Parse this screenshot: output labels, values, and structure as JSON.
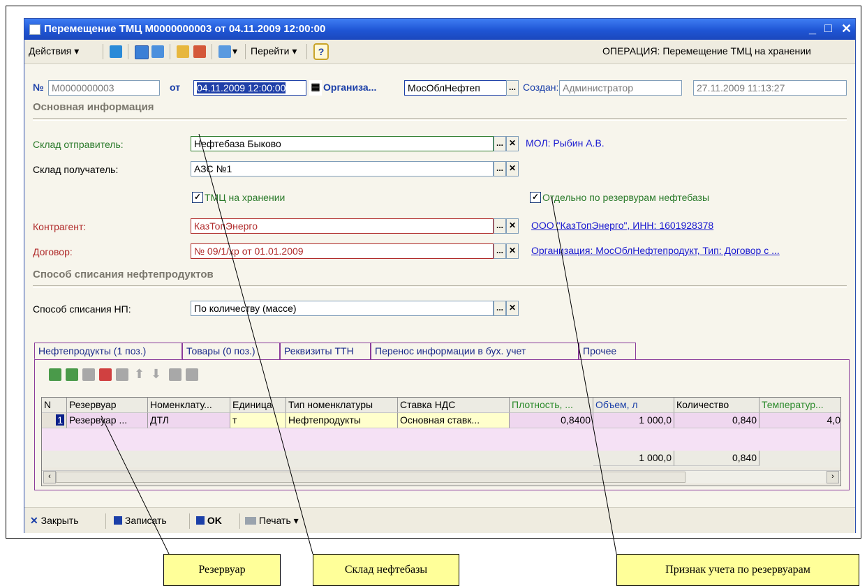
{
  "window": {
    "title": "Перемещение ТМЦ М0000000003 от 04.11.2009 12:00:00"
  },
  "toolbar": {
    "actions_label": "Действия",
    "goto_label": "Перейти",
    "help_label": "?",
    "operation_text": "ОПЕРАЦИЯ: Перемещение ТМЦ на хранении"
  },
  "header": {
    "number_label": "№",
    "number_value": "М0000000003",
    "from_label": "от",
    "date_value": "04.11.2009 12:00:00",
    "org_label": "Организа...",
    "org_value": "МосОблНефтеп",
    "created_label": "Создан:",
    "created_by": "Администратор",
    "created_at": "27.11.2009 11:13:27"
  },
  "main_section": {
    "title": "Основная информация",
    "sender_label": "Склад отправитель:",
    "sender_value": "Нефтебаза Быково",
    "sender_mol": "МОЛ: Рыбин А.В.",
    "receiver_label": "Склад получатель:",
    "receiver_value": "АЗС №1",
    "storage_checkbox_label": "ТМЦ на хранении",
    "reservoirs_checkbox_label": "Отдельно по резервурам нефтебазы",
    "contractor_label": "Контрагент:",
    "contractor_value": "КазТопЭнерго",
    "contractor_link": "ООО \"КазТопЭнерго\", ИНН: 1601928378",
    "contract_label": "Договор:",
    "contract_value": "№ 09/1/хр от 01.01.2009",
    "contract_link": "Организация: МосОблНефтепродукт, Тип: Договор с ..."
  },
  "writeoff_section": {
    "title": "Способ списания нефтепродуктов",
    "method_label": "Способ списания НП:",
    "method_value": "По количеству (массе)"
  },
  "tabs": [
    {
      "label": "Нефтепродукты (1 поз.)"
    },
    {
      "label": "Товары (0 поз.)"
    },
    {
      "label": "Реквизиты ТТН"
    },
    {
      "label": "Перенос информации в бух. учет"
    },
    {
      "label": "Прочее"
    }
  ],
  "table": {
    "columns": [
      "N",
      "Резервуар",
      "Номенклату...",
      "Единица",
      "Тип номенклатуры",
      "Ставка НДС",
      "Плотность, ...",
      "Объем, л",
      "Количество",
      "Температур..."
    ],
    "rows": [
      [
        "1",
        "Резервуар ...",
        "ДТЛ",
        "т",
        "Нефтепродукты",
        "Основная ставк...",
        "0,8400",
        "1 000,0",
        "0,840",
        "4,0"
      ]
    ],
    "totals": {
      "volume": "1 000,0",
      "quantity": "0,840"
    }
  },
  "bottom": {
    "close_label": "Закрыть",
    "save_label": "Записать",
    "ok_label": "OK",
    "print_label": "Печать"
  },
  "callouts": {
    "reservoir": "Резервуар",
    "warehouse": "Склад нефтебазы",
    "flag": "Признак учета по резервуарам"
  },
  "colors": {
    "title_bar": "#1f55d4",
    "window_bg": "#f7f5ec",
    "link": "#1818d0",
    "required_label": "#b02a2a",
    "sender_label": "#2a7a2a",
    "tab_border": "#8a3b9a",
    "callout_bg": "#ffff99",
    "row_pink": "#efd7ef",
    "row_yellow": "#ffffcc"
  }
}
